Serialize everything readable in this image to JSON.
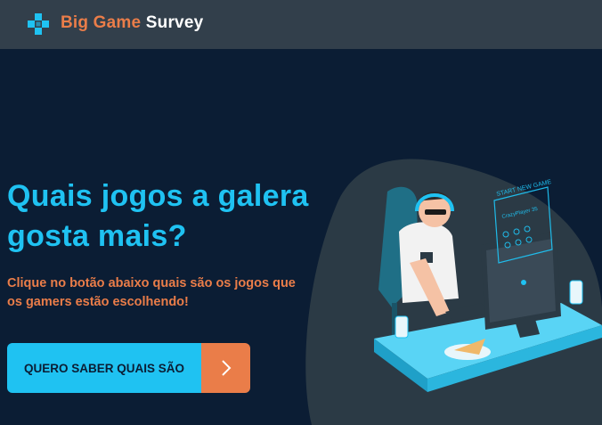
{
  "header": {
    "brand_part1": "Big Game",
    "brand_part2": " Survey",
    "logo_icon": "gamepad-icon"
  },
  "hero": {
    "title": "Quais jogos a galera gosta mais?",
    "subtitle": "Clique no botão abaixo quais são os jogos que os gamers estão escolhendo!",
    "cta_label": "QUERO SABER QUAIS SÃO",
    "cta_icon": "chevron-right-icon"
  },
  "illustration": {
    "hud_title": "START NEW GAME",
    "hud_player": "CrazyPlayer 35"
  },
  "colors": {
    "background": "#0b1d34",
    "header": "#323f4b",
    "accent_blue": "#1fc2f2",
    "accent_orange": "#ea7d49"
  }
}
